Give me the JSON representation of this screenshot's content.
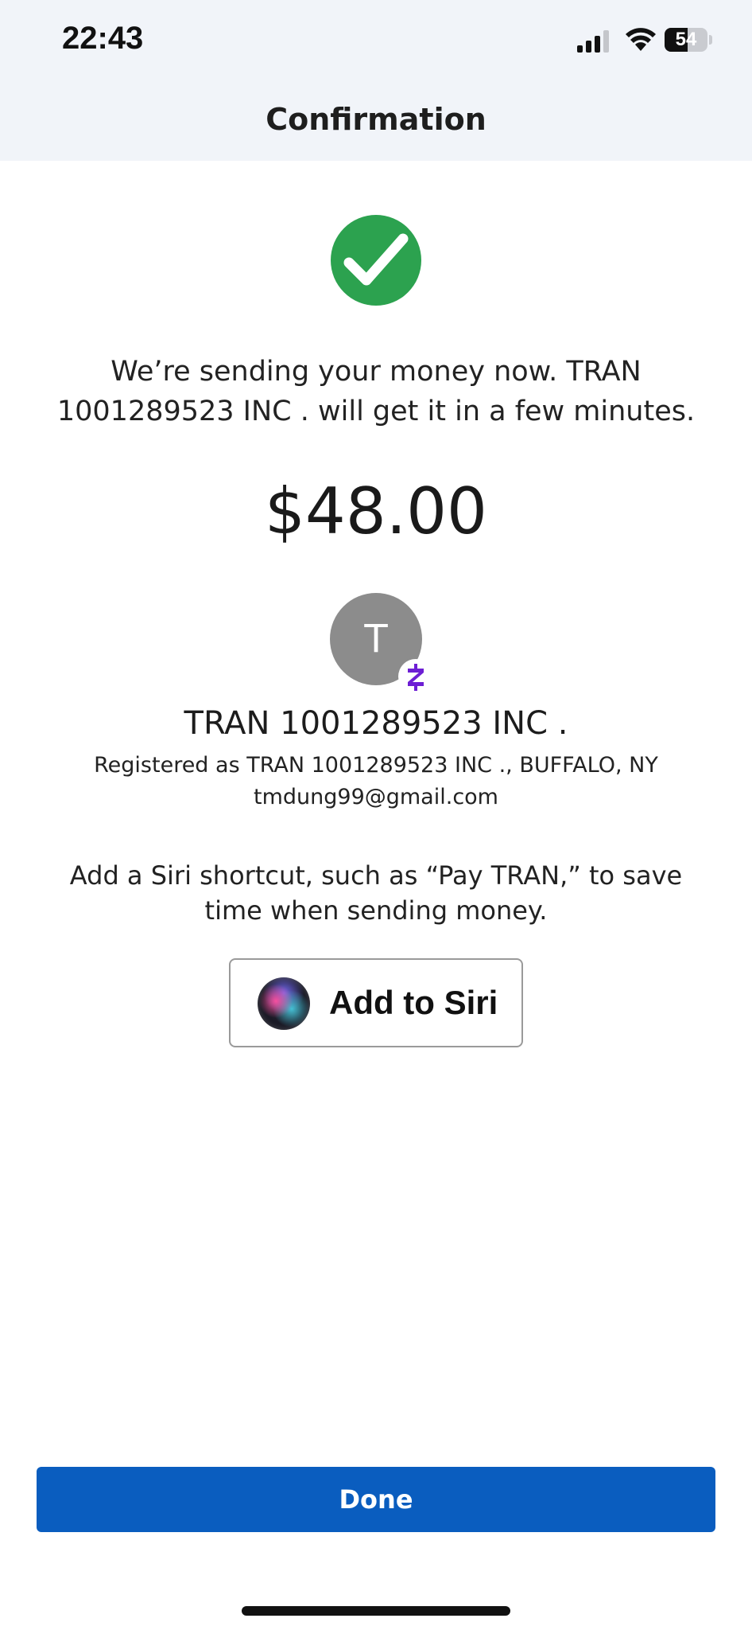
{
  "status_bar": {
    "time": "22:43",
    "battery_level": "54",
    "battery_fraction": 0.54
  },
  "header": {
    "title": "Confirmation"
  },
  "confirmation": {
    "icon": "checkmark-circle-icon",
    "icon_color": "#2ca24f",
    "message": "We’re sending your money now. TRAN 1001289523 INC . will get it in a few minutes.",
    "amount": "$48.00"
  },
  "recipient": {
    "avatar_letter": "T",
    "badge_icon": "zelle-icon",
    "badge_color": "#6d1ed4",
    "name": "TRAN 1001289523 INC .",
    "registered": "Registered as TRAN 1001289523 INC ., BUFFALO, NY",
    "email": "tmdung99@gmail.com"
  },
  "siri": {
    "prompt": "Add a Siri shortcut, such as “Pay TRAN,” to save time when sending money.",
    "button_label": "Add to Siri",
    "icon": "siri-orb-icon"
  },
  "footer": {
    "done_label": "Done",
    "accent_color": "#0a5dbf"
  }
}
